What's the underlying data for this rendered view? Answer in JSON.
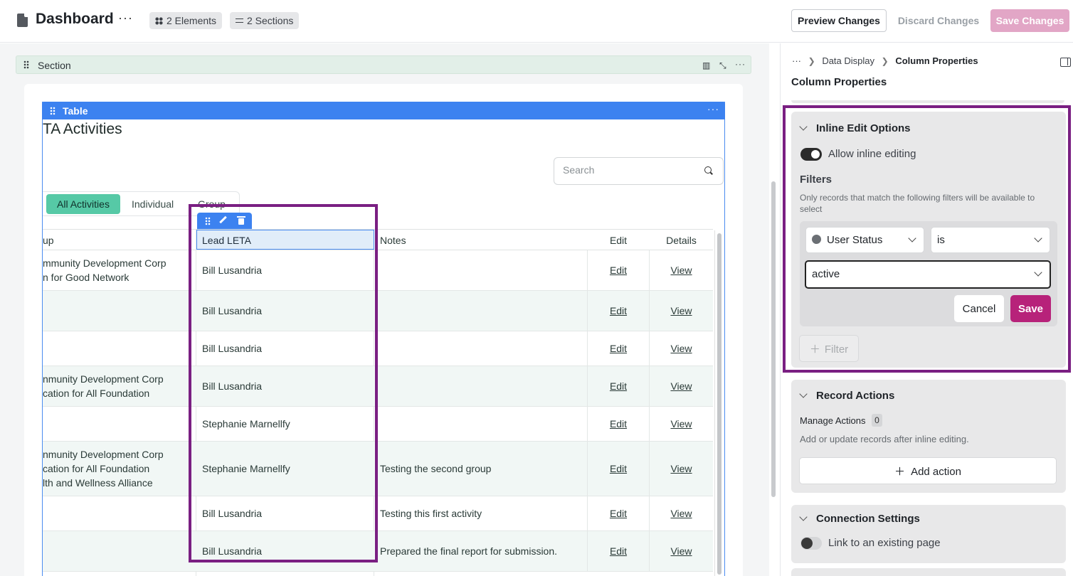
{
  "header": {
    "title": "Dashboard",
    "more": "···",
    "elements_chip": "2 Elements",
    "sections_chip": "2 Sections",
    "preview": "Preview Changes",
    "discard": "Discard Changes",
    "save": "Save Changes"
  },
  "canvas": {
    "section_label": "Section",
    "table_label": "Table",
    "table_more": "···",
    "table_title": "TA Activities",
    "search_placeholder": "Search",
    "tabs": [
      "All Activities",
      "Individual",
      "Group"
    ],
    "columns": {
      "group": "up",
      "lead": "Lead LETA",
      "notes": "Notes",
      "edit": "Edit",
      "details": "Details"
    },
    "rows": [
      {
        "group": [
          "mmunity Development Corp",
          "n for Good Network"
        ],
        "lead": "Bill Lusandria",
        "notes": "",
        "edit": "Edit",
        "view": "View"
      },
      {
        "group": [],
        "lead": "Bill Lusandria",
        "notes": "",
        "edit": "Edit",
        "view": "View"
      },
      {
        "group": [],
        "lead": "Bill Lusandria",
        "notes": "",
        "edit": "Edit",
        "view": "View"
      },
      {
        "group": [
          "nmunity Development Corp",
          "cation for All Foundation"
        ],
        "lead": "Bill Lusandria",
        "notes": "",
        "edit": "Edit",
        "view": "View"
      },
      {
        "group": [],
        "lead": "Stephanie Marnellfy",
        "notes": "",
        "edit": "Edit",
        "view": "View"
      },
      {
        "group": [
          "nmunity Development Corp",
          "cation for All Foundation",
          "lth and Wellness Alliance"
        ],
        "lead": "Stephanie Marnellfy",
        "notes": "Testing the second group",
        "edit": "Edit",
        "view": "View"
      },
      {
        "group": [],
        "lead": "Bill Lusandria",
        "notes": "Testing this first activity",
        "edit": "Edit",
        "view": "View"
      },
      {
        "group": [],
        "lead": "Bill Lusandria",
        "notes": "Prepared the final report for submission.",
        "edit": "Edit",
        "view": "View"
      }
    ]
  },
  "panel": {
    "breadcrumb": [
      "···",
      "Data Display",
      "Column Properties"
    ],
    "title": "Column Properties",
    "inline_edit": {
      "heading": "Inline Edit Options",
      "toggle_label": "Allow inline editing",
      "toggle_on": true,
      "filters_heading": "Filters",
      "filters_help": "Only records that match the following filters will be available to select",
      "filter_field": "User Status",
      "filter_operator": "is",
      "filter_value": "active",
      "cancel": "Cancel",
      "save": "Save",
      "add_filter": "Filter"
    },
    "record_actions": {
      "heading": "Record Actions",
      "manage_label": "Manage Actions",
      "manage_count": "0",
      "help": "Add or update records after inline editing.",
      "add_action": "Add action"
    },
    "connection": {
      "heading": "Connection Settings",
      "toggle_label": "Link to an existing page",
      "toggle_on": false
    }
  },
  "colors": {
    "highlight": "#7a1f82",
    "accent_blue": "#3c82f0",
    "tab_active": "#56c9a6",
    "save_button": "#b7227a"
  }
}
